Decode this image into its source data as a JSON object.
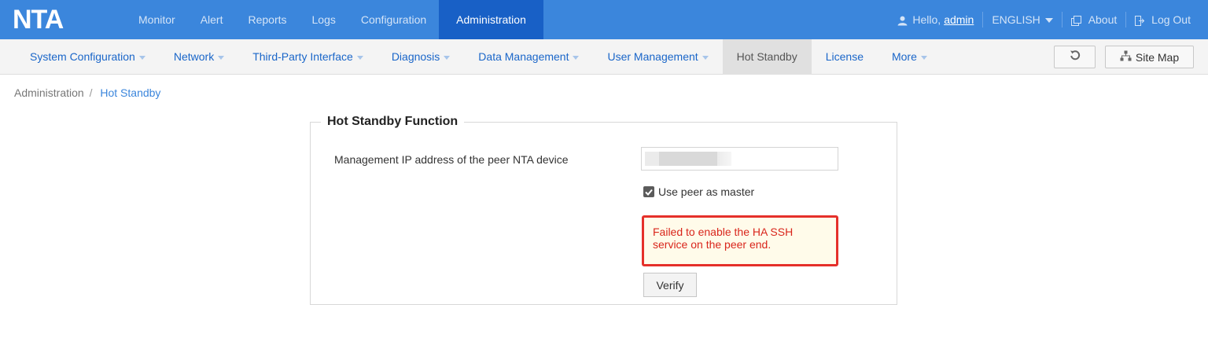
{
  "app": {
    "logo": "NTA"
  },
  "top_nav": [
    {
      "label": "Monitor"
    },
    {
      "label": "Alert"
    },
    {
      "label": "Reports"
    },
    {
      "label": "Logs"
    },
    {
      "label": "Configuration"
    },
    {
      "label": "Administration",
      "active": true
    }
  ],
  "top_right": {
    "greeting": "Hello,",
    "username": "admin",
    "language": "ENGLISH",
    "about_label": "About",
    "logout_label": "Log Out"
  },
  "sub_nav": [
    {
      "label": "System Configuration",
      "dropdown": true
    },
    {
      "label": "Network",
      "dropdown": true
    },
    {
      "label": "Third-Party Interface",
      "dropdown": true
    },
    {
      "label": "Diagnosis",
      "dropdown": true
    },
    {
      "label": "Data Management",
      "dropdown": true
    },
    {
      "label": "User Management",
      "dropdown": true
    },
    {
      "label": "Hot Standby",
      "active": true
    },
    {
      "label": "License"
    },
    {
      "label": "More",
      "dropdown": true
    }
  ],
  "toolbar": {
    "site_map_label": "Site Map"
  },
  "breadcrumb": {
    "parent": "Administration",
    "separator": "/",
    "current": "Hot Standby"
  },
  "panel": {
    "title": "Hot Standby Function",
    "ip_label": "Management IP address of the peer NTA device",
    "ip_value": "",
    "use_peer_label": "Use peer as master",
    "use_peer_checked": true,
    "error_message": "Failed to enable the HA SSH service on the peer end.",
    "verify_label": "Verify"
  },
  "colors": {
    "header_bg": "#3b86dc",
    "active_tab_bg": "#1860c6",
    "link": "#1a66c9",
    "error_border": "#e5302a",
    "error_text": "#d9261c"
  }
}
